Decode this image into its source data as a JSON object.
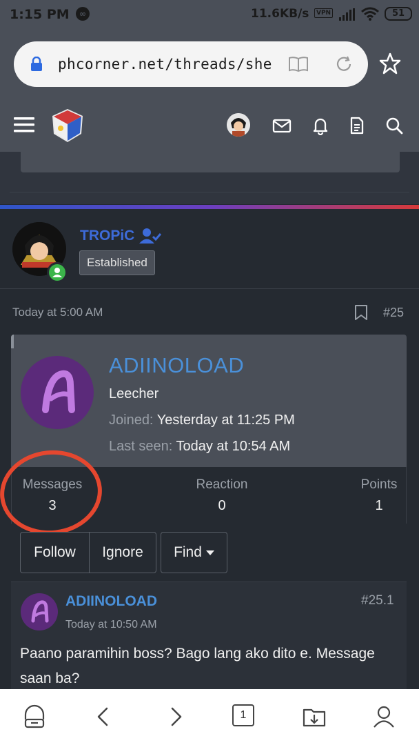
{
  "status_bar": {
    "time": "1:15 PM",
    "network_speed": "11.6KB/s",
    "vpn": "VPN",
    "battery": "51"
  },
  "browser": {
    "url": "phcorner.net/threads/she"
  },
  "post": {
    "author_name": "TROPiC",
    "author_badge": "Established",
    "date": "Today at 5:00 AM",
    "post_number": "#25"
  },
  "profile_card": {
    "username": "ADIINOLOAD",
    "role": "Leecher",
    "joined_label": "Joined:",
    "joined_value": "Yesterday at 11:25 PM",
    "last_seen_label": "Last seen:",
    "last_seen_value": "Today at 10:54 AM",
    "stats": [
      {
        "label": "Messages",
        "value": "3"
      },
      {
        "label": "Reaction",
        "value": "0"
      },
      {
        "label": "Points",
        "value": "1"
      }
    ],
    "buttons": {
      "follow": "Follow",
      "ignore": "Ignore",
      "find": "Find"
    }
  },
  "reply": {
    "author": "ADIINOLOAD",
    "number": "#25.1",
    "date": "Today at 10:50 AM",
    "text": "Paano paramihin boss? Bago lang ako dito e. Message saan ba?"
  },
  "bottom_nav": {
    "tab_count": "1"
  },
  "colors": {
    "accent_blue": "#4a90d9",
    "author_blue": "#3d6bd9",
    "highlight_red": "#e5472f",
    "online_green": "#3bb54a",
    "avatar_purple": "#5b2a7a"
  }
}
